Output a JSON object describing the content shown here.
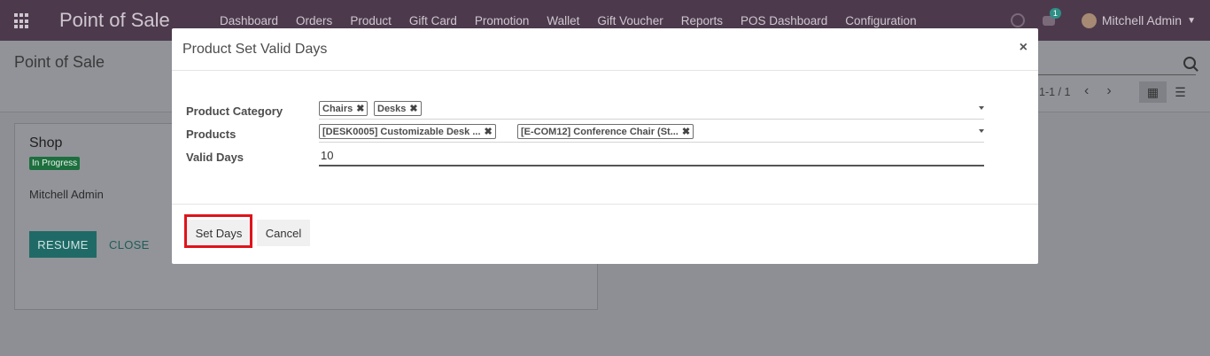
{
  "navbar": {
    "brand": "Point of Sale",
    "menu": [
      "Dashboard",
      "Orders",
      "Product",
      "Gift Card",
      "Promotion",
      "Wallet",
      "Gift Voucher",
      "Reports",
      "POS Dashboard",
      "Configuration"
    ],
    "chat_count": "1",
    "user_name": "Mitchell Admin"
  },
  "control_panel": {
    "breadcrumb": "Point of Sale",
    "pager": "1-1 / 1"
  },
  "card": {
    "title": "Shop",
    "status": "In Progress",
    "user": "Mitchell Admin",
    "resume_label": "RESUME",
    "close_label": "CLOSE"
  },
  "modal": {
    "title": "Product Set Valid Days",
    "close_symbol": "×",
    "fields": {
      "category_label": "Product Category",
      "category_tags": [
        "Chairs",
        "Desks"
      ],
      "products_label": "Products",
      "product_tags": [
        "[DESK0005] Customizable Desk ...",
        "[E-COM12] Conference Chair (St..."
      ],
      "valid_days_label": "Valid Days",
      "valid_days_value": "10"
    },
    "buttons": {
      "set_days": "Set Days",
      "cancel": "Cancel"
    },
    "tag_remove_symbol": "✖"
  },
  "colors": {
    "navbar": "#4c3a4c",
    "highlight": "#e0131b",
    "badge": "#1d6f3e",
    "primary": "#1f6a66"
  }
}
